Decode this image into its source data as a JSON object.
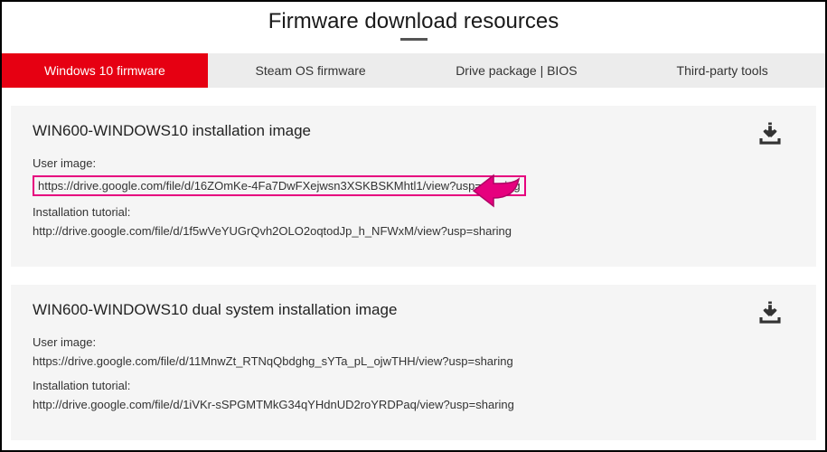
{
  "page": {
    "title": "Firmware download resources"
  },
  "tabs": [
    {
      "label": "Windows 10 firmware",
      "active": true
    },
    {
      "label": "Steam OS firmware",
      "active": false
    },
    {
      "label": "Drive package | BIOS",
      "active": false
    },
    {
      "label": "Third-party tools",
      "active": false
    }
  ],
  "cards": [
    {
      "title": "WIN600-WINDOWS10 installation image",
      "user_image_label": "User image:",
      "user_image_url": "https://drive.google.com/file/d/16ZOmKe-4Fa7DwFXejwsn3XSKBSKMhtl1/view?usp=sharing",
      "tutorial_label": "Installation tutorial:",
      "tutorial_url": "http://drive.google.com/file/d/1f5wVeYUGrQvh2OLO2oqtodJp_h_NFWxM/view?usp=sharing",
      "highlighted": true
    },
    {
      "title": "WIN600-WINDOWS10 dual system installation image",
      "user_image_label": "User image:",
      "user_image_url": "https://drive.google.com/file/d/11MnwZt_RTNqQbdghg_sYTa_pL_ojwTHH/view?usp=sharing",
      "tutorial_label": "Installation tutorial:",
      "tutorial_url": "http://drive.google.com/file/d/1iVKr-sSPGMTMkG34qYHdnUD2roYRDPaq/view?usp=sharing",
      "highlighted": false
    }
  ]
}
